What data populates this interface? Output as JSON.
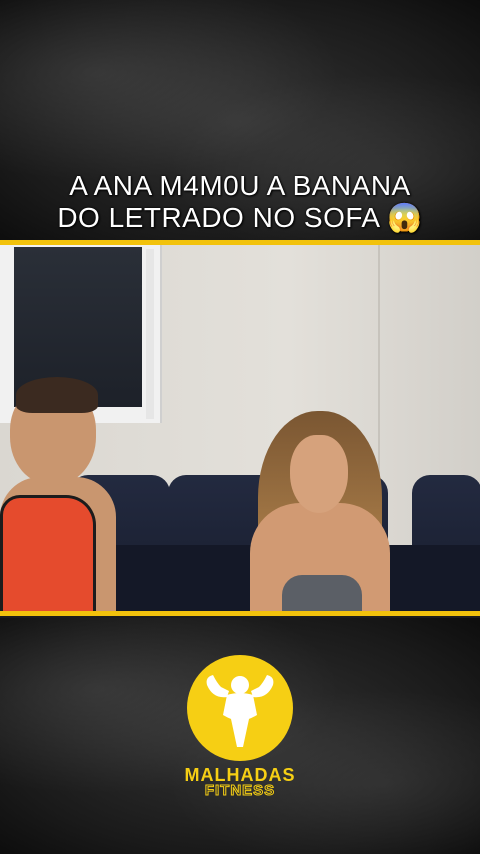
{
  "caption": {
    "line1": "A ANA M4M0U A BANANA",
    "line2": "DO LETRADO NO SOFA 😱"
  },
  "logo": {
    "name": "MALHADAS",
    "subtitle": "FITNESS",
    "icon": "bodybuilder-icon"
  },
  "colors": {
    "accent": "#f2c20c",
    "background": "#1c1c1c",
    "caption_text": "#ffffff"
  }
}
